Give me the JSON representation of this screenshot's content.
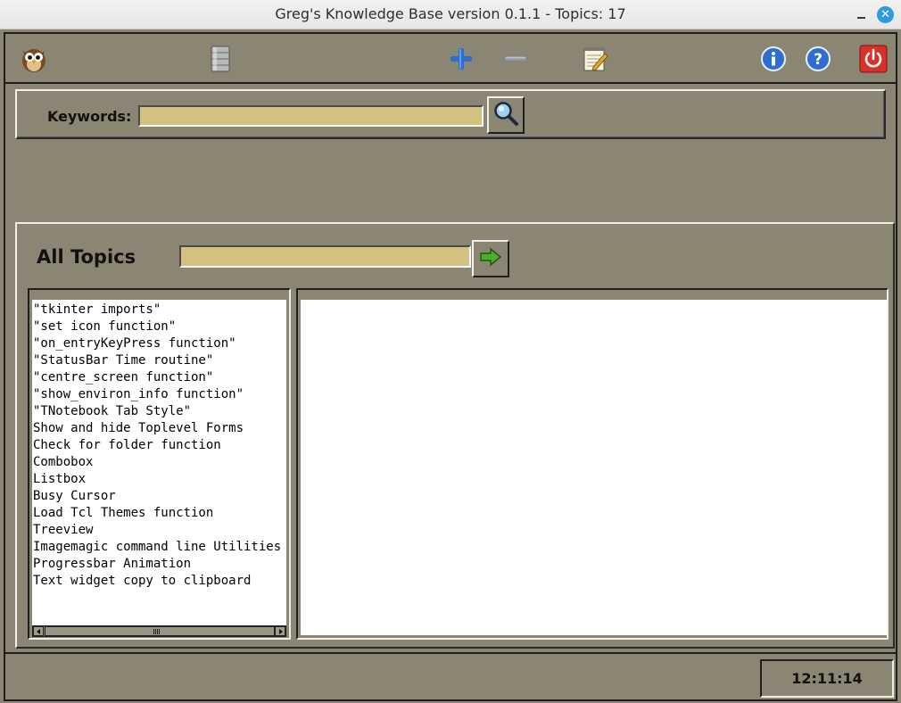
{
  "window": {
    "title": "Greg's Knowledge Base version 0.1.1 - Topics: 17"
  },
  "toolbar": {
    "icons": [
      "owl-icon",
      "database-icon",
      "add-icon",
      "remove-icon",
      "edit-note-icon",
      "info-icon",
      "help-icon",
      "power-icon"
    ]
  },
  "search": {
    "label": "Keywords:",
    "value": "",
    "button_icon": "magnifier-icon"
  },
  "topics": {
    "title": "All Topics",
    "value": "",
    "button_icon": "arrow-right-icon",
    "items": [
      "\"tkinter imports\"",
      "\"set icon function\"",
      "\"on_entryKeyPress function\"",
      "\"StatusBar Time routine\"",
      "\"centre_screen function\"",
      "\"show_environ_info function\"",
      "\"TNotebook Tab Style\"",
      "Show and hide Toplevel Forms",
      "Check for folder function",
      "Combobox",
      "Listbox",
      "Busy Cursor",
      "Load Tcl Themes function",
      "Treeview",
      "Imagemagic command line Utilities",
      "Progressbar Animation",
      "Text widget copy to clipboard"
    ]
  },
  "content": {
    "text": ""
  },
  "status": {
    "time": "12:11:14"
  },
  "colors": {
    "background": "#8b8573",
    "entry": "#d3c27f",
    "accent_blue": "#2d6fd0",
    "power_red": "#d9302a"
  }
}
